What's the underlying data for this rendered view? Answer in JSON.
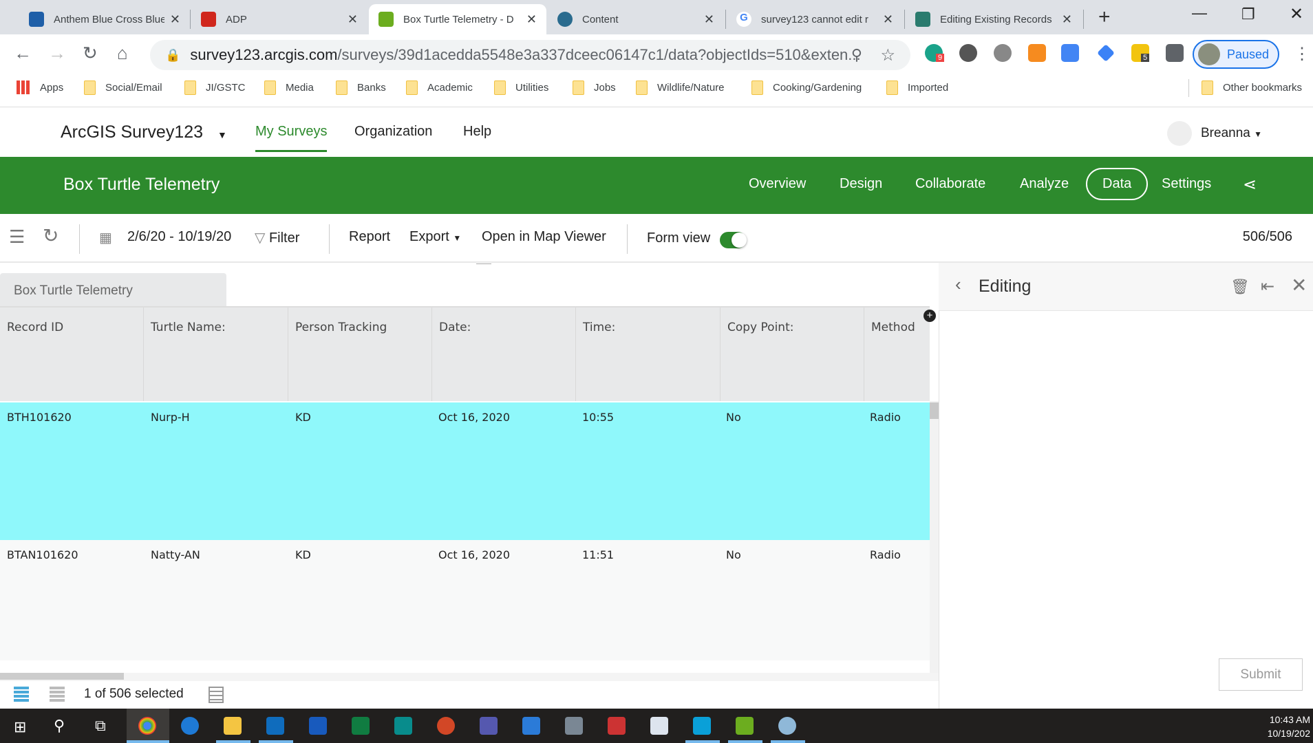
{
  "browser": {
    "tabs": [
      {
        "title": "Anthem Blue Cross Blue",
        "color": "#1f5fa8"
      },
      {
        "title": "ADP",
        "color": "#d0271d"
      },
      {
        "title": "Box Turtle Telemetry - D",
        "color": "#6cad1f"
      },
      {
        "title": "Content",
        "color": "#2a6b8e"
      },
      {
        "title": "survey123 cannot edit r",
        "color": "#4285f4"
      },
      {
        "title": "Editing Existing Records",
        "color": "#2a7b6e"
      }
    ],
    "url_host": "survey123.arcgis.com",
    "url_path": "/surveys/39d1acedda5548e3a337dceec06147c1/data?objectIds=510&exten...",
    "ext_badges": [
      "9",
      "5"
    ],
    "profile": "Paused",
    "bookmarks": [
      "Apps",
      "Social/Email",
      "JI/GSTC",
      "Media",
      "Banks",
      "Academic",
      "Utilities",
      "Jobs",
      "Wildlife/Nature",
      "Cooking/Gardening",
      "Imported"
    ],
    "other_bookmarks": "Other bookmarks"
  },
  "app": {
    "name": "ArcGIS Survey123",
    "nav": [
      "My Surveys",
      "Organization",
      "Help"
    ],
    "user": "Breanna"
  },
  "survey": {
    "title": "Box Turtle Telemetry",
    "nav": [
      "Overview",
      "Design",
      "Collaborate",
      "Analyze",
      "Data",
      "Settings"
    ],
    "active": "Data"
  },
  "toolbar": {
    "date_range": "2/6/20 - 10/19/20",
    "filter": "Filter",
    "report": "Report",
    "export": "Export",
    "map_viewer": "Open in Map Viewer",
    "form_view": "Form view",
    "form_view_on": true,
    "count": "506/506"
  },
  "table": {
    "sheet": "Box Turtle Telemetry",
    "columns": [
      "Record ID",
      "Turtle Name:",
      "Person Tracking",
      "Date:",
      "Time:",
      "Copy Point:",
      "Method"
    ],
    "rows": [
      [
        "BTH101620",
        "Nurp-H",
        "KD",
        "Oct 16, 2020",
        "10:55",
        "No",
        "Radio"
      ],
      [
        "BTAN101620",
        "Natty-AN",
        "KD",
        "Oct 16, 2020",
        "11:51",
        "No",
        "Radio"
      ]
    ],
    "selected_color": "#8ff8fb",
    "status": "1 of 506 selected"
  },
  "editing": {
    "title": "Editing",
    "submit": "Submit"
  },
  "taskbar": {
    "time": "10:43 AM",
    "date": "10/19/202"
  }
}
